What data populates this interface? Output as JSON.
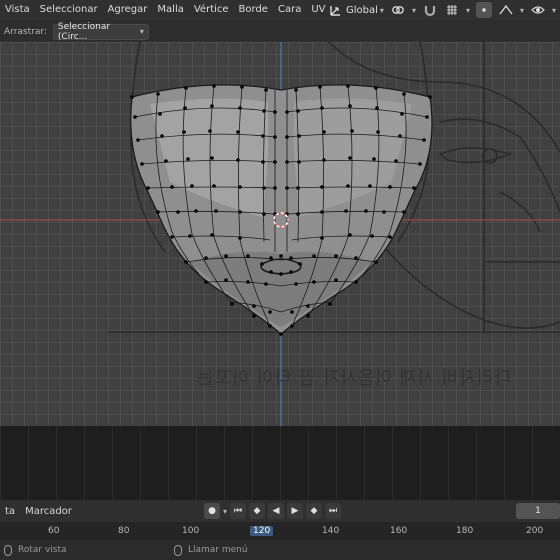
{
  "header": {
    "menus": [
      "Vista",
      "Seleccionar",
      "Agregar",
      "Malla",
      "Vértice",
      "Borde",
      "Cara",
      "UV"
    ],
    "orientation": "Global"
  },
  "toolbar": {
    "drag_label": "Arrastrar:",
    "select_value": "Seleccionar (Circ..."
  },
  "viewport": {
    "reference_text": "다리자비 사재 이음사자 끔 타이 이꼬는"
  },
  "timeline": {
    "menu_left": "ta",
    "menu_marker": "Marcador",
    "current_frame": "1",
    "ruler_ticks": [
      "60",
      "80",
      "100",
      "120",
      "140",
      "160",
      "180",
      "200"
    ],
    "ruler_current": "120"
  },
  "status": {
    "left_action": "Rotar vista",
    "right_action": "Llamar menú"
  },
  "colors": {
    "header_bg": "#303030",
    "viewport_bg": "#404040",
    "accent_blue": "#3d5a80",
    "axis_red": "#b34a4a",
    "axis_blue": "#4a8ad0"
  }
}
